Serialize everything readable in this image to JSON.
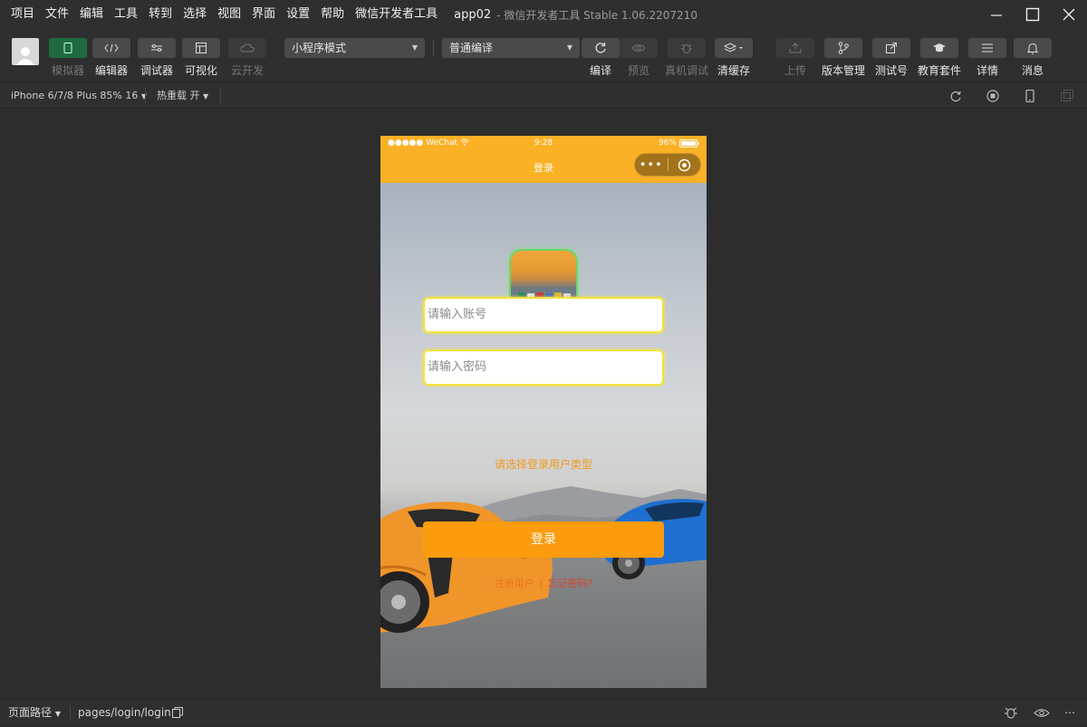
{
  "menu": {
    "items": [
      "项目",
      "文件",
      "编辑",
      "工具",
      "转到",
      "选择",
      "视图",
      "界面",
      "设置",
      "帮助",
      "微信开发者工具"
    ],
    "window_title": "app02",
    "window_subtitle": "- 微信开发者工具 Stable 1.06.2207210"
  },
  "toolbar": {
    "simulator": "模拟器",
    "editor": "编辑器",
    "debugger": "调试器",
    "visual": "可视化",
    "cloud": "云开发",
    "mode_select": "小程序模式",
    "compile_select": "普通编译",
    "compile": "编译",
    "preview": "预览",
    "remote_debug": "真机调试",
    "clear_cache": "清缓存",
    "upload": "上传",
    "version": "版本管理",
    "test_account": "测试号",
    "education": "教育套件",
    "details": "详情",
    "messages": "消息"
  },
  "subbar": {
    "device": "iPhone 6/7/8 Plus 85% 16",
    "hot_reload": "热重载 开"
  },
  "phone": {
    "carrier": "●●●●● WeChat",
    "time": "9:28",
    "battery": "96%",
    "nav_title": "登录",
    "capsule_dots": "•••"
  },
  "login": {
    "account_placeholder": "请输入账号",
    "password_placeholder": "请输入密码",
    "user_type": "请选择登录用户类型",
    "login_button": "登录",
    "register": "注册用户",
    "separator": "|",
    "forgot": "忘记密码?"
  },
  "bottombar": {
    "page_path_label": "页面路径",
    "page_path": "pages/login/login"
  },
  "colors": {
    "accent": "#fbb125",
    "button": "#fb9b0e",
    "input_border": "#f5e23a"
  }
}
